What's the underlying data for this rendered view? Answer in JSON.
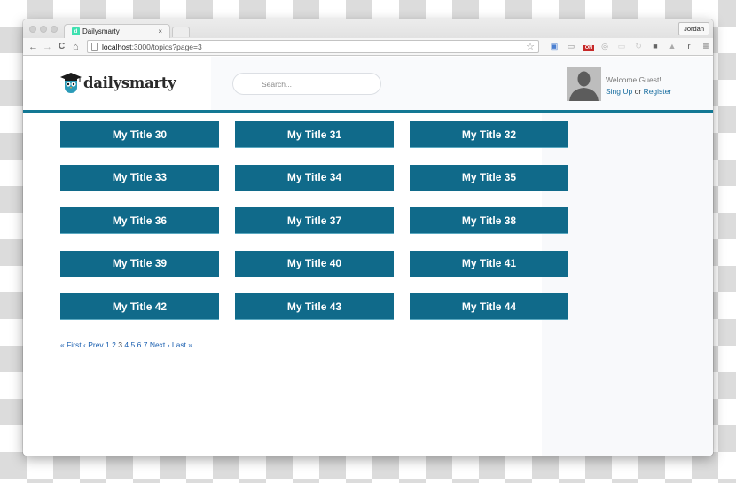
{
  "browser": {
    "tab_title": "Dailysmarty",
    "tab_favicon_letter": "d",
    "tab_close": "×",
    "profile_name": "Jordan",
    "url_host": "localhost",
    "url_path": ":3000/topics?page=3",
    "nav": {
      "back": "←",
      "forward": "→",
      "reload": "C",
      "home": "⌂"
    },
    "bookmark_star": "☆",
    "extensions": [
      {
        "name": "files-extension-icon",
        "glyph": "▣",
        "color": "#4a7fd1"
      },
      {
        "name": "cast-icon",
        "glyph": "▭",
        "color": "#888888"
      },
      {
        "name": "on-badge-extension-icon",
        "glyph": "ON",
        "color": "#c62828"
      },
      {
        "name": "circle-extension-icon",
        "glyph": "◎",
        "color": "#aaaaaa"
      },
      {
        "name": "card-extension-icon",
        "glyph": "▭",
        "color": "#cccccc"
      },
      {
        "name": "sync-extension-icon",
        "glyph": "↻",
        "color": "#cccccc"
      },
      {
        "name": "square-extension-icon",
        "glyph": "■",
        "color": "#666666"
      },
      {
        "name": "drive-extension-icon",
        "glyph": "▲",
        "color": "#aaaaaa"
      },
      {
        "name": "r-extension-icon",
        "glyph": "r",
        "color": "#555555"
      },
      {
        "name": "menu-icon",
        "glyph": "≡",
        "color": "#666666"
      }
    ]
  },
  "site": {
    "logo_text": "dailysmarty",
    "brand_color": "#106a8a",
    "search": {
      "placeholder": "Search...",
      "value": ""
    },
    "user": {
      "welcome": "Welcome Guest!",
      "signup_label": "Sing Up",
      "or_text": "or",
      "register_label": "Register"
    }
  },
  "topics": [
    {
      "title": "My Title 30"
    },
    {
      "title": "My Title 31"
    },
    {
      "title": "My Title 32"
    },
    {
      "title": "My Title 33"
    },
    {
      "title": "My Title 34"
    },
    {
      "title": "My Title 35"
    },
    {
      "title": "My Title 36"
    },
    {
      "title": "My Title 37"
    },
    {
      "title": "My Title 38"
    },
    {
      "title": "My Title 39"
    },
    {
      "title": "My Title 40"
    },
    {
      "title": "My Title 41"
    },
    {
      "title": "My Title 42"
    },
    {
      "title": "My Title 43"
    },
    {
      "title": "My Title 44"
    }
  ],
  "pagination": {
    "first": "« First",
    "sep1": " ‹ ",
    "prev": "Prev",
    "pages": [
      "1",
      "2",
      "3",
      "4",
      "5",
      "6",
      "7"
    ],
    "current_page": "3",
    "next": "Next",
    "sep2": " › ",
    "last": "Last »"
  }
}
